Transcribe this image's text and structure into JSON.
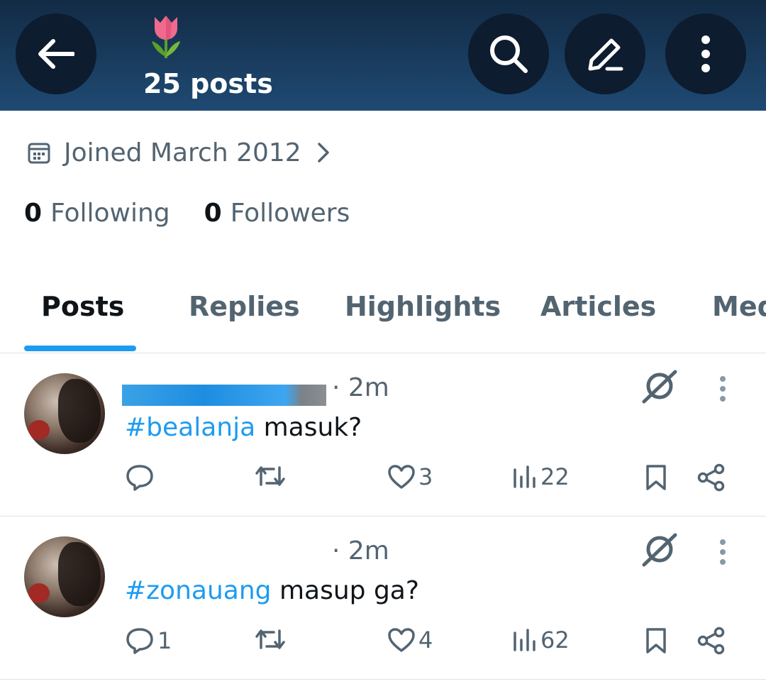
{
  "header": {
    "title_emoji": "🌷",
    "posts_count": "25 posts",
    "icons": {
      "back": "arrow-left-icon",
      "search": "search-icon",
      "edit": "pencil-icon",
      "more": "more-vertical-icon"
    }
  },
  "profile": {
    "joined": "Joined March 2012",
    "following_count": "0",
    "following_label": "Following",
    "followers_count": "0",
    "followers_label": "Followers"
  },
  "tabs": [
    {
      "label": "Posts",
      "active": true
    },
    {
      "label": "Replies",
      "active": false
    },
    {
      "label": "Highlights",
      "active": false
    },
    {
      "label": "Articles",
      "active": false
    },
    {
      "label": "Media",
      "active": false
    }
  ],
  "posts": [
    {
      "time": "· 2m",
      "hashtag": "#bealanja",
      "text": " masuk?",
      "replies": "",
      "retweets": "",
      "likes": "3",
      "views": "22"
    },
    {
      "time": "· 2m",
      "hashtag": "#zonauang",
      "text": " masup ga?",
      "replies": "1",
      "retweets": "",
      "likes": "4",
      "views": "62"
    }
  ],
  "colors": {
    "accent": "#1d9bf0",
    "header_dark": "#122b45",
    "muted_text": "#536471"
  }
}
